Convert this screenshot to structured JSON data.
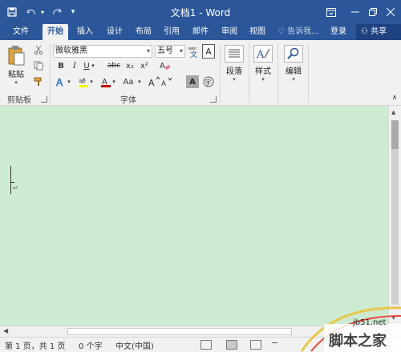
{
  "titlebar": {
    "title": "文档1 - Word",
    "save_icon": "save-icon",
    "undo_icon": "undo-icon",
    "redo_icon": "redo-icon",
    "customize_icon": "customize-qat-icon",
    "ribbon_options_icon": "ribbon-display-options-icon",
    "minimize_icon": "minimize-icon",
    "restore_icon": "restore-icon",
    "close_icon": "close-icon"
  },
  "tabs": {
    "file": "文件",
    "home": "开始",
    "insert": "插入",
    "design": "设计",
    "layout": "布局",
    "references": "引用",
    "mailings": "邮件",
    "review": "审阅",
    "view": "视图",
    "tell_me": "告诉我...",
    "login": "登录",
    "share": "共享"
  },
  "ribbon": {
    "clipboard": {
      "paste_label": "粘贴",
      "group_label": "剪贴板"
    },
    "font": {
      "font_name": "微软雅黑",
      "font_size": "五号",
      "bold": "B",
      "italic": "I",
      "underline": "U",
      "strikethrough": "abc",
      "subscript": "x₂",
      "superscript": "x²",
      "change_case": "Aa",
      "char_border": "A",
      "phonetic": "文",
      "group_label": "字体"
    },
    "paragraph": {
      "label": "段落"
    },
    "styles": {
      "label": "样式"
    },
    "editing": {
      "label": "编辑"
    }
  },
  "statusbar": {
    "page": "第 1 页，共 1 页",
    "words": "0 个字",
    "language": "中文(中国)"
  },
  "watermark": {
    "url": "jb51.net",
    "name": "脚本之家"
  },
  "colors": {
    "brand": "#2b579a",
    "document_bg": "#cdebd1",
    "highlight_yellow": "#ffff00",
    "font_red": "#c00000"
  }
}
